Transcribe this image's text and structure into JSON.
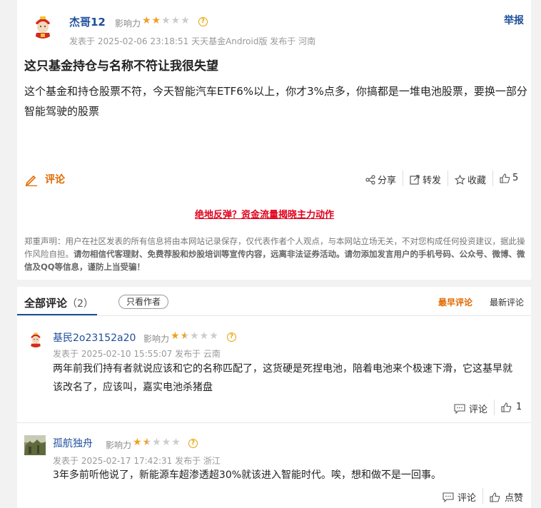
{
  "post": {
    "author": "杰哥12",
    "influence_label": "影响力",
    "influence_stars": 2,
    "meta": "发表于 2025-02-06 23:18:51 天天基金Android版 发布于 河南",
    "report_label": "举报",
    "title": "这只基金持仓与名称不符让我很失望",
    "body": "这个基金和持仓股票不符，今天智能汽车ETF6%以上，你才3%点多，你搞都是一堆电池股票，要换一部分智能驾驶的股票",
    "comment_label": "评论",
    "share_label": "分享",
    "forward_label": "转发",
    "collect_label": "收藏",
    "like_count": "5",
    "promo_link": "绝地反弹？资金流量揭晓主力动作",
    "disclaimer_prefix": "郑重声明：用户在社区发表的所有信息将由本网站记录保存，仅代表作者个人观点，与本网站立场无关，不对您构成任何投资建议，据此操作风险自担。",
    "disclaimer_bold": "请勿相信代客理财、免费荐股和炒股培训等宣传内容，远离非法证券活动。请勿添加发言用户的手机号码、公众号、微博、微信及QQ等信息，谨防上当受骗！"
  },
  "comments_section": {
    "tab_label": "全部评论",
    "tab_count": "（2）",
    "author_only_label": "只看作者",
    "sort_earliest": "最早评论",
    "sort_latest": "最新评论",
    "items": [
      {
        "author": "基民2o23152a20",
        "influence_label": "影响力",
        "influence_stars": 1.5,
        "meta": "发表于 2025-02-10 15:55:07 发布于 云南",
        "text": "两年前我们持有者就说应该和它的名称匹配了，这货硬是死捏电池，陪着电池来个极速下滑，它这基早就该改名了，应该叫，嘉实电池杀猪盘",
        "comment_label": "评论",
        "like_label": "1"
      },
      {
        "author": "孤航独舟",
        "influence_label": "影响力",
        "influence_stars": 1.5,
        "meta": "发表于 2025-02-17 17:42:31 发布于 浙江",
        "text": "3年多前听他说了，新能源车超渗透超30%就该进入智能时代。唉，想和做不是一回事。",
        "comment_label": "评论",
        "like_label": "点赞"
      }
    ]
  },
  "colors": {
    "link_blue": "#1e4e9a",
    "accent_orange": "#e06a00",
    "promo_red": "#e0001b",
    "star_gold": "#f0a020"
  }
}
